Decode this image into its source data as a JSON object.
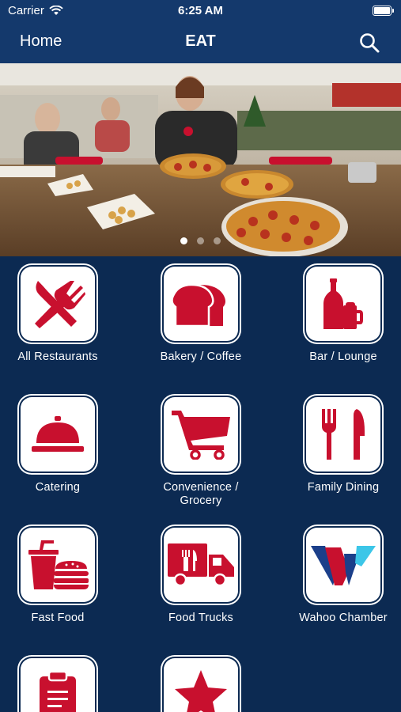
{
  "status": {
    "carrier": "Carrier",
    "time": "6:25 AM"
  },
  "nav": {
    "back_label": "Home",
    "title": "EAT",
    "search_icon": "search-icon"
  },
  "carousel": {
    "page_count": 3,
    "active_index": 0
  },
  "categories": [
    {
      "label": "All Restaurants",
      "icon": "fork-knife-crossed-icon"
    },
    {
      "label": "Bakery / Coffee",
      "icon": "bread-icon"
    },
    {
      "label": "Bar / Lounge",
      "icon": "bottle-mug-icon"
    },
    {
      "label": "Catering",
      "icon": "cloche-icon"
    },
    {
      "label": "Convenience / Grocery",
      "icon": "shopping-cart-icon"
    },
    {
      "label": "Family Dining",
      "icon": "fork-knife-icon"
    },
    {
      "label": "Fast Food",
      "icon": "drink-burger-icon"
    },
    {
      "label": "Food Trucks",
      "icon": "food-truck-icon"
    },
    {
      "label": "Wahoo Chamber",
      "icon": "wahoo-logo-icon"
    },
    {
      "label": "",
      "icon": "clipboard-icon"
    },
    {
      "label": "",
      "icon": "star-icon"
    }
  ],
  "colors": {
    "background": "#0c2a52",
    "bar": "#14396c",
    "icon_red": "#c8102e",
    "logo_blue": "#1b3f8a",
    "logo_cyan": "#3cc6e8"
  }
}
